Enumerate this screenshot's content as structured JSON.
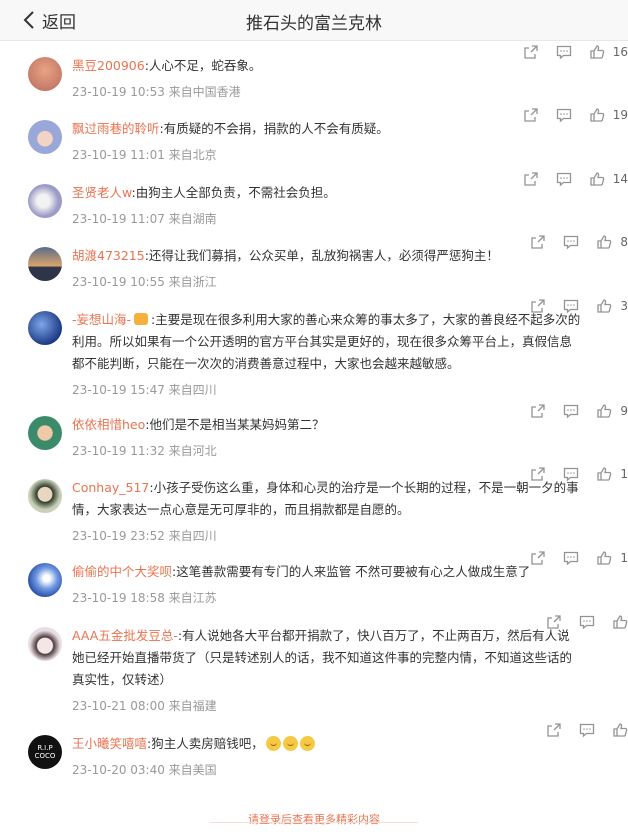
{
  "header": {
    "back_label": "返回",
    "title": "推石头的富兰克林"
  },
  "comments": [
    {
      "user": "黑豆200906",
      "text": ":人心不足，蛇吞象。",
      "meta": "23-10-19 10:53 来自中国香港",
      "likes": "16",
      "avatar": "#c9867a"
    },
    {
      "user": "飘过雨巷的聆听",
      "text": ":有质疑的不会捐，捐款的人不会有质疑。",
      "meta": "23-10-19 11:01 来自北京",
      "likes": "19",
      "avatar": "#9aa7d9"
    },
    {
      "user": "圣贤老人w",
      "text": ":由狗主人全部负责，不需社会负担。",
      "meta": "23-10-19 11:07 来自湖南",
      "likes": "14",
      "avatar": "#b7b7d8"
    },
    {
      "user": "胡渡473215",
      "text": ":还得让我们募捐，公众买单，乱放狗祸害人，必须得严惩狗主！",
      "meta": "23-10-19 10:55 来自浙江",
      "likes": "8",
      "avatar": "#4b5a78"
    },
    {
      "user": "-妄想山海-",
      "text": ":主要是现在很多利用大家的善心来众筹的事太多了，大家的善良经不起多次的利用。所以如果有一个公开透明的官方平台其实是更好的，现在很多众筹平台上，真假信息都不能判断，只能在一次次的消费善意过程中，大家也会越来越敏感。",
      "meta": "23-10-19 15:47 来自四川",
      "likes": "3",
      "avatar": "#2d4f9c"
    },
    {
      "user": "依依相惜heo",
      "text": ":他们是不是相当某某妈妈第二？",
      "meta": "23-10-19 11:32 来自河北",
      "likes": "9",
      "avatar": "#3b8b6a"
    },
    {
      "user": "Conhay_517",
      "text": ":小孩子受伤这么重，身体和心灵的治疗是一个长期的过程，不是一朝一夕的事情，大家表达一点心意是无可厚非的，而且捐款都是自愿的。",
      "meta": "23-10-19 23:52 来自四川",
      "likes": "1",
      "avatar": "#6e7f5a"
    },
    {
      "user": "偷偷的中个大奖呗",
      "text": ":这笔善款需要有专门的人来监管 不然可要被有心之人做成生意了",
      "meta": "23-10-19 18:58 来自江苏",
      "likes": "1",
      "avatar": "#3f67b8"
    },
    {
      "user": "AAA五金批发豆总-",
      "text": ":有人说她各大平台都开捐款了，快八百万了，不止两百万，然后有人说她已经开始直播带货了（只是转述别人的话，我不知道这件事的完整内情，不知道这些话的真实性，仅转述）",
      "meta": "23-10-21 08:00 来自福建",
      "likes": "",
      "avatar": "#d9c9cf"
    },
    {
      "user": "王小曦笑嘻嘻",
      "text": ":狗主人卖房赔钱吧，",
      "meta": "23-10-20 03:40 来自美国",
      "likes": "",
      "avatar": "#111111",
      "avatar_text": "R.I.P COCO"
    }
  ],
  "footer": {
    "login_prompt": "请登录后查看更多精彩内容"
  },
  "colors": {
    "username": "#eb7350",
    "meta": "#999999",
    "action_icon": "#939393"
  },
  "icons": [
    "chevron-left-icon",
    "share-icon",
    "comment-icon",
    "like-icon"
  ]
}
